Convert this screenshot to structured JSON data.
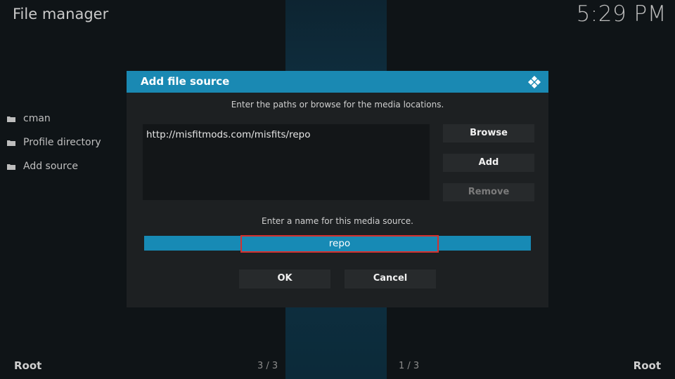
{
  "header": {
    "title": "File manager",
    "clock": "5:29 PM"
  },
  "sidebar": {
    "items": [
      {
        "label": "cman",
        "icon": "folder-icon"
      },
      {
        "label": "Profile directory",
        "icon": "folder-icon"
      },
      {
        "label": "Add source",
        "icon": "folder-icon"
      }
    ]
  },
  "footer": {
    "left": "Root",
    "left_count": "3 / 3",
    "right_count": "1 / 3",
    "right": "Root"
  },
  "dialog": {
    "title": "Add file source",
    "icon": "kodi-logo-icon",
    "paths_hint": "Enter the paths or browse for the media locations.",
    "paths": [
      "http://misfitmods.com/misfits/repo"
    ],
    "buttons": {
      "browse": "Browse",
      "add": "Add",
      "remove": "Remove"
    },
    "name_hint": "Enter a name for this media source.",
    "name_value": "repo",
    "ok": "OK",
    "cancel": "Cancel"
  },
  "colors": {
    "accent": "#1a89b3",
    "highlight_border": "#d5312f",
    "dialog_bg": "#1d2022"
  }
}
